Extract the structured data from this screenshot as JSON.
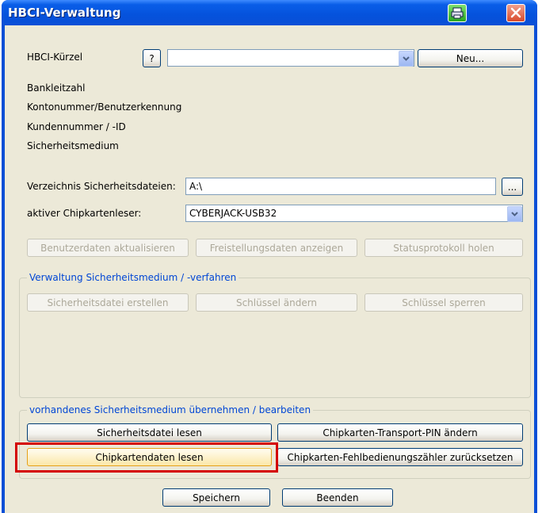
{
  "window": {
    "title": "HBCI-Verwaltung"
  },
  "labels": {
    "kuerzel": "HBCI-Kürzel",
    "blz": "Bankleitzahl",
    "konto": "Kontonummer/Benutzerkennung",
    "kunde": "Kundennummer / -ID",
    "medium": "Sicherheitsmedium",
    "verzeichnis": "Verzeichnis Sicherheitsdateien:",
    "leser": "aktiver Chipkartenleser:"
  },
  "buttons": {
    "help": "?",
    "neu": "Neu...",
    "browse": "...",
    "benutzerdaten": "Benutzerdaten aktualisieren",
    "freistellung": "Freistellungsdaten anzeigen",
    "statusprotokoll": "Statusprotokoll holen",
    "datei_erstellen": "Sicherheitsdatei erstellen",
    "schluessel_aendern": "Schlüssel ändern",
    "schluessel_sperren": "Schlüssel sperren",
    "datei_lesen": "Sicherheitsdatei lesen",
    "pin_aendern": "Chipkarten-Transport-PIN ändern",
    "chipdaten_lesen": "Chipkartendaten lesen",
    "fehlbedienung": "Chipkarten-Fehlbedienungszähler zurücksetzen",
    "speichern": "Speichern",
    "beenden": "Beenden"
  },
  "fields": {
    "kuerzel_value": "",
    "verzeichnis_value": "A:\\",
    "leser_value": "CYBERJACK-USB32"
  },
  "groups": {
    "verwaltung": "Verwaltung Sicherheitsmedium / -verfahren",
    "vorhanden": "vorhandenes Sicherheitsmedium übernehmen / bearbeiten"
  },
  "icons": {
    "printer": "printer-icon",
    "close": "close-icon"
  },
  "colors": {
    "titlebar": "#0a4fd6",
    "group_title": "#0046d5",
    "highlight": "#d40000"
  }
}
